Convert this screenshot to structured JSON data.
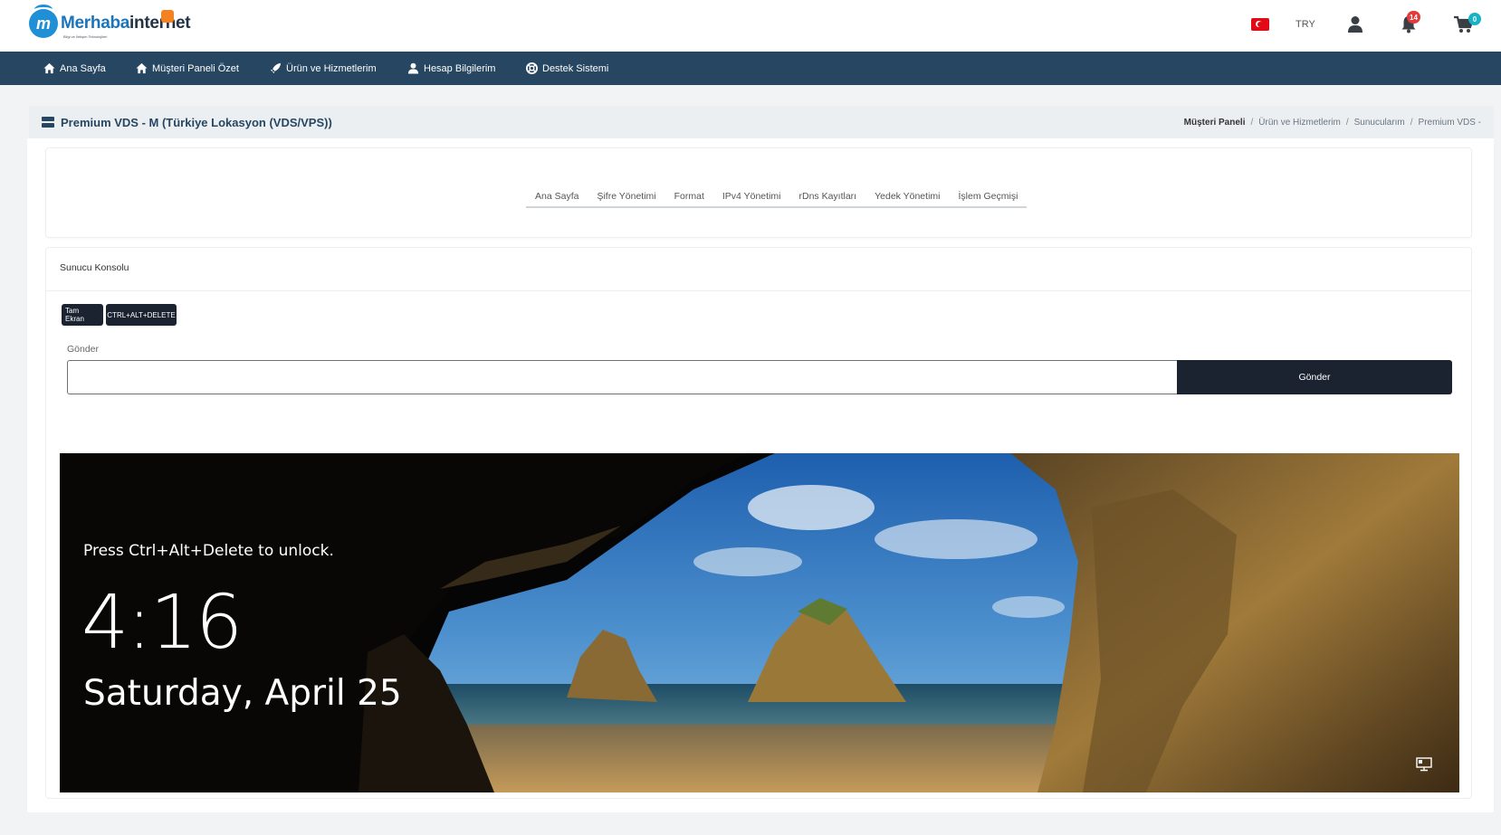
{
  "header": {
    "logo_text_a": "Merhaba",
    "logo_text_b": "internet",
    "logo_sub": "Bilgi ve İletişim Teknolojileri",
    "currency": "TRY",
    "notifications_count": "14",
    "cart_count": "0"
  },
  "nav": {
    "items": [
      {
        "label": "Ana Sayfa",
        "icon": "home-icon"
      },
      {
        "label": "Müşteri Paneli Özet",
        "icon": "home-icon"
      },
      {
        "label": "Ürün ve Hizmetlerim",
        "icon": "rocket-icon"
      },
      {
        "label": "Hesap Bilgilerim",
        "icon": "user-icon"
      },
      {
        "label": "Destek Sistemi",
        "icon": "support-icon"
      }
    ]
  },
  "page": {
    "title": "Premium VDS - M (Türkiye Lokasyon (VDS/VPS))",
    "breadcrumb": [
      "Müşteri Paneli",
      "Ürün ve Hizmetlerim",
      "Sunucularım",
      "Premium VDS -"
    ]
  },
  "tabs": [
    "Ana Sayfa",
    "Şifre Yönetimi",
    "Format",
    "IPv4 Yönetimi",
    "rDns Kayıtları",
    "Yedek Yönetimi",
    "İşlem Geçmişi"
  ],
  "console": {
    "title": "Sunucu Konsolu",
    "fullscreen_label": "Tam Ekran",
    "cad_label": "CTRL+ALT+DELETE",
    "send_label": "Gönder",
    "send_input_value": "",
    "send_button": "Gönder",
    "lock_message": "Press Ctrl+Alt+Delete to unlock.",
    "time": "4:16",
    "date": "Saturday, April 25"
  },
  "colors": {
    "navbar": "#264662",
    "dark_button": "#1b2230",
    "notification_badge": "#e23b3b",
    "cart_badge": "#16b2c6"
  }
}
